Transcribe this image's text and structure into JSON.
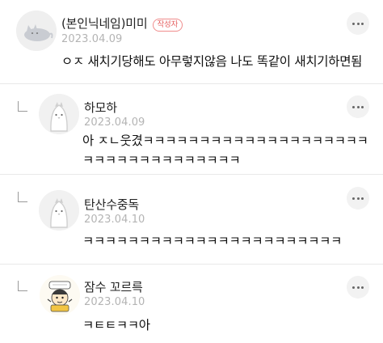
{
  "comments": [
    {
      "author": "(본인닉네임)미미",
      "badge": "작성자",
      "date": "2023.04.09",
      "text": "ㅇㅈ 새치기당해도 아무렇지않음 나도 똑같이 새치기하면됨",
      "avatar_icon": "cat-icon"
    },
    {
      "author": "하모하",
      "date": "2023.04.09",
      "text": "아 ㅈㄴ웃겼ㅋㅋㅋㅋㅋㅋㅋㅋㅋㅋㅋㅋㅋㅋㅋㅋㅋㅋㅋㅋㅋㅋㅋㅋㅋㅋㅋㅋㅋㅋㅋㅋㅋㅋ",
      "avatar_icon": "penguin-icon"
    },
    {
      "author": "탄산수중독",
      "date": "2023.04.10",
      "text": "ㅋㅋㅋㅋㅋㅋㅋㅋㅋㅋㅋㅋㅋㅋㅋㅋㅋㅋㅋㅋㅋㅋㅋ",
      "avatar_icon": "penguin-icon"
    },
    {
      "author": "잠수 꼬르륵",
      "date": "2023.04.10",
      "text": "ㅋㅌㅌㅋㅋ아",
      "avatar_icon": "cartoon-character-icon"
    }
  ],
  "colors": {
    "badge": "#e45c5c",
    "date": "#b4b4b4",
    "divider": "#e9e9e9"
  }
}
